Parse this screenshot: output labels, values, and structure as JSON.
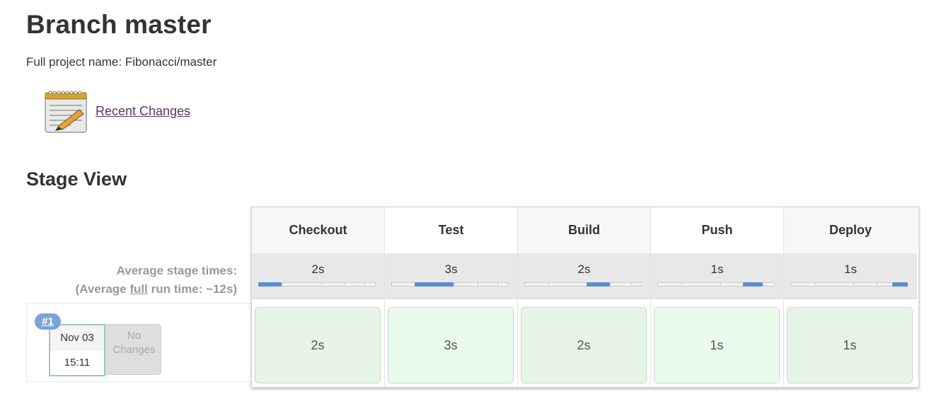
{
  "page": {
    "title": "Branch master",
    "full_project_name": "Full project name: Fibonacci/master",
    "recent_changes_label": "Recent Changes",
    "stage_view_title": "Stage View"
  },
  "stage_view": {
    "average_label_line1": "Average stage times:",
    "average_label_prefix": "(Average ",
    "average_label_link": "full",
    "average_label_suffix": " run time: ~12s)",
    "stages": [
      {
        "name": "Checkout",
        "avg_time": "2s",
        "bar_start_fraction": 0.0,
        "bar_end_fraction": 0.2
      },
      {
        "name": "Test",
        "avg_time": "3s",
        "bar_start_fraction": 0.2,
        "bar_end_fraction": 0.53
      },
      {
        "name": "Build",
        "avg_time": "2s",
        "bar_start_fraction": 0.53,
        "bar_end_fraction": 0.73
      },
      {
        "name": "Push",
        "avg_time": "1s",
        "bar_start_fraction": 0.73,
        "bar_end_fraction": 0.9
      },
      {
        "name": "Deploy",
        "avg_time": "1s",
        "bar_start_fraction": 0.87,
        "bar_end_fraction": 1.0
      }
    ],
    "runs": [
      {
        "number": "#1",
        "date": "Nov 03",
        "time": "15:11",
        "changes": "No Changes",
        "stage_times": [
          "2s",
          "3s",
          "2s",
          "1s",
          "1s"
        ]
      }
    ]
  },
  "colors": {
    "success_cell": "#e6f5e6",
    "progress_bar": "#5b8dd3",
    "run_badge": "#7ba4d4",
    "link": "#5c3566"
  }
}
